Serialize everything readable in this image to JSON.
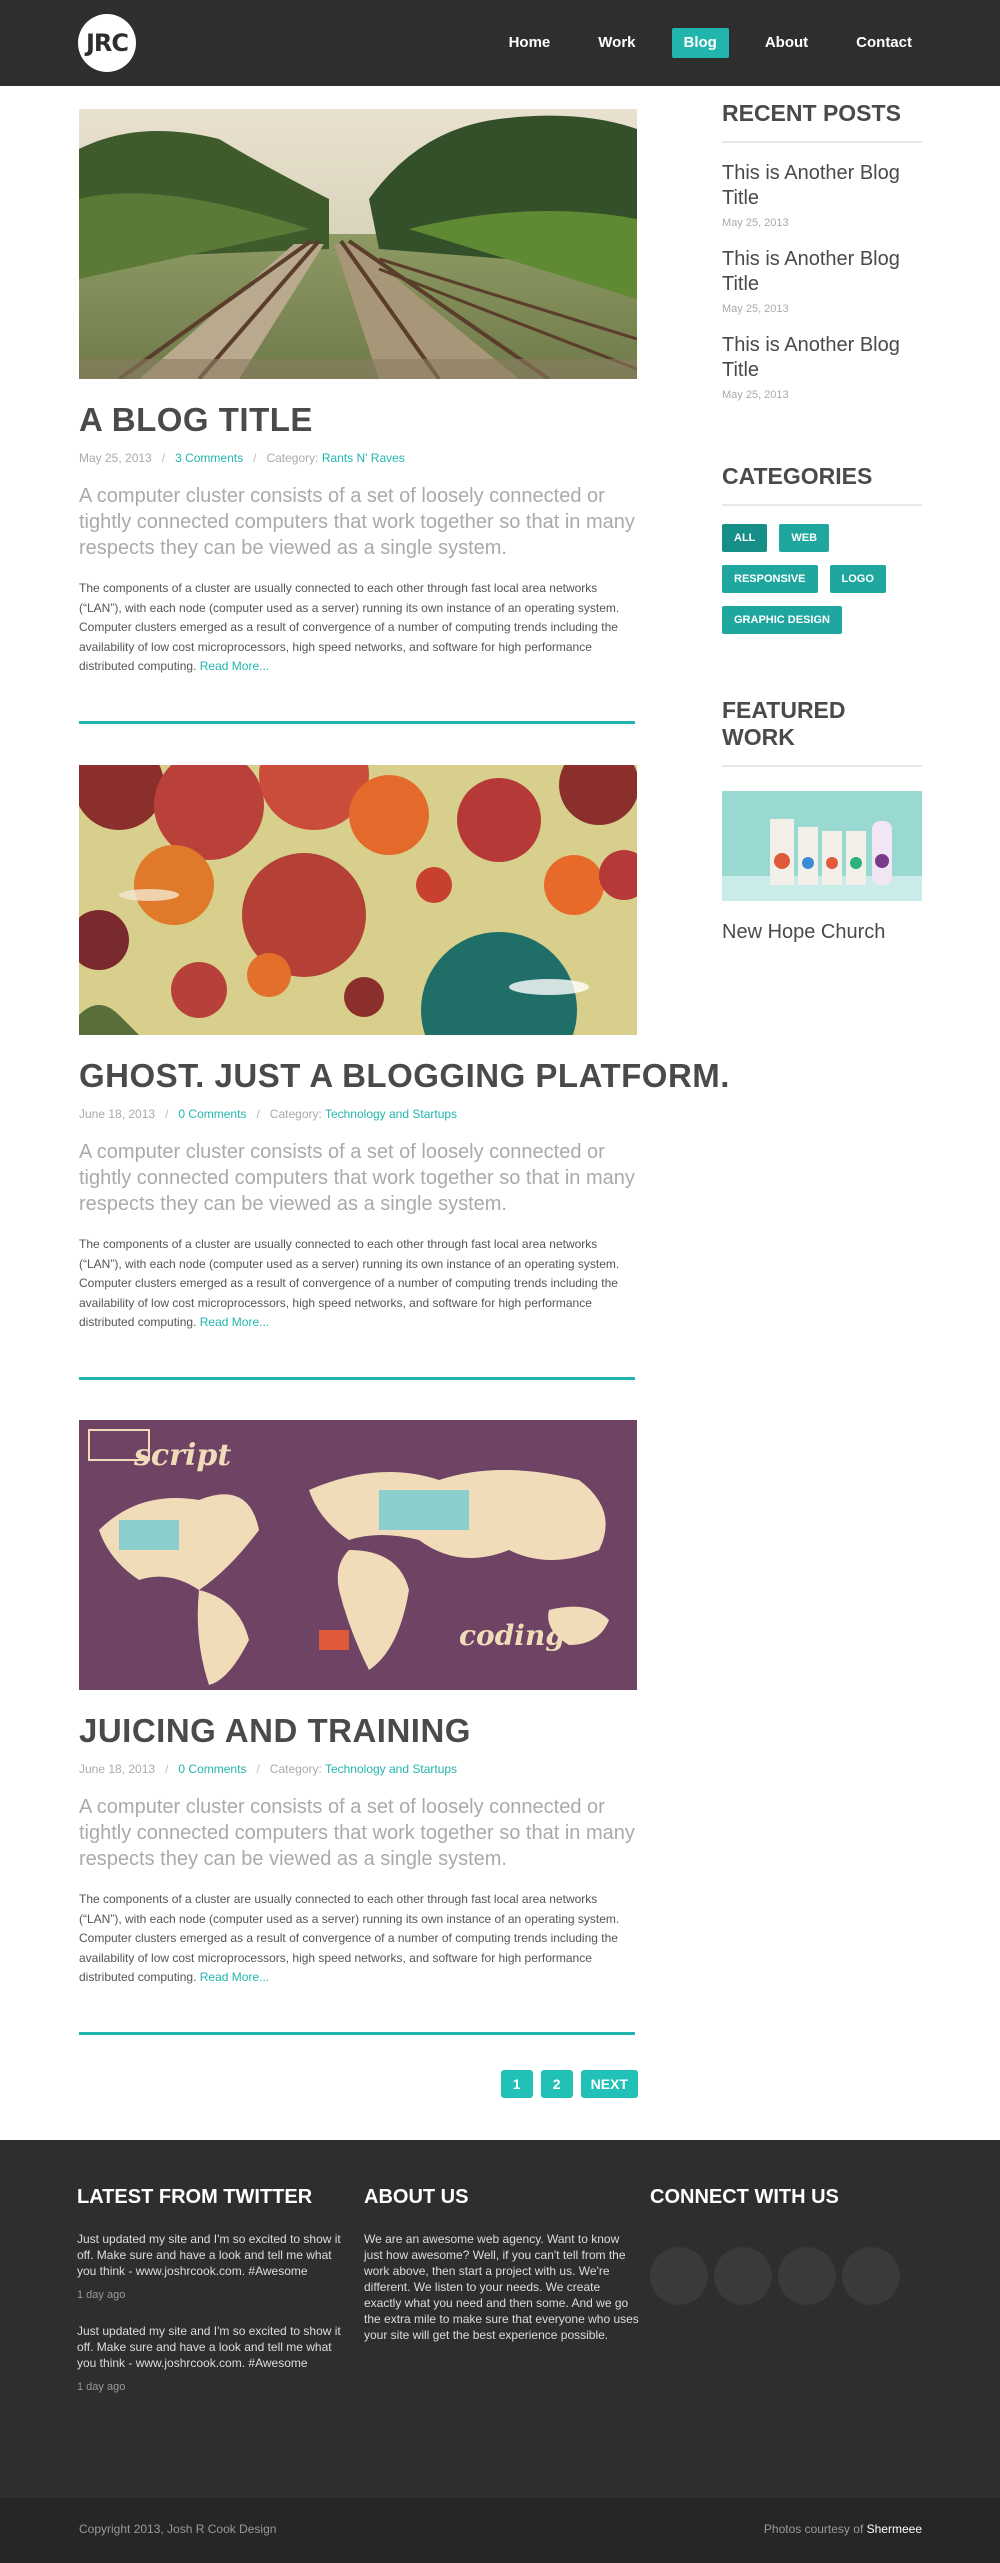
{
  "header": {
    "logo": "JRC",
    "nav": [
      {
        "label": "Home",
        "active": false
      },
      {
        "label": "Work",
        "active": false
      },
      {
        "label": "Blog",
        "active": true
      },
      {
        "label": "About",
        "active": false
      },
      {
        "label": "Contact",
        "active": false
      }
    ]
  },
  "posts": [
    {
      "title": "A BLOG TITLE",
      "date": "May 25, 2013",
      "comments": "3 Comments",
      "category_label": "Category:",
      "category": "Rants N' Raves",
      "lead": "A computer cluster consists of a set of loosely connected or tightly connected computers that work together so that in many respects they can be viewed as a single system.",
      "body": "The components of a cluster are usually connected to each other through fast local area networks (“LAN”), with each node (computer used as a server) running its own instance of an operating system. Computer clusters emerged as a result of convergence of a number of computing trends including the availability of low cost microprocessors, high speed networks, and software for high performance distributed computing.",
      "read_more": "Read More..."
    },
    {
      "title": "GHOST. JUST A BLOGGING PLATFORM.",
      "date": "June 18, 2013",
      "comments": "0 Comments",
      "category_label": "Category:",
      "category": "Technology and Startups",
      "lead": "A computer cluster consists of a set of loosely connected or tightly connected computers that work together so that in many respects they can be viewed as a single system.",
      "body": "The components of a cluster are usually connected to each other through fast local area networks (“LAN”), with each node (computer used as a server) running its own instance of an operating system. Computer clusters emerged as a result of convergence of a number of computing trends including the availability of low cost microprocessors, high speed networks, and software for high performance distributed computing.",
      "read_more": "Read More..."
    },
    {
      "title": "JUICING AND TRAINING",
      "date": "June 18, 2013",
      "comments": "0 Comments",
      "category_label": "Category:",
      "category": "Technology and Startups",
      "lead": "A computer cluster consists of a set of loosely connected or tightly connected computers that work together so that in many respects they can be viewed as a single system.",
      "body": "The components of a cluster are usually connected to each other through fast local area networks (“LAN”), with each node (computer used as a server) running its own instance of an operating system. Computer clusters emerged as a result of convergence of a number of computing trends including the availability of low cost microprocessors, high speed networks, and software for high performance distributed computing.",
      "read_more": "Read More...",
      "image_text": [
        "script",
        "coding"
      ]
    }
  ],
  "sidebar": {
    "recent_heading": "RECENT POSTS",
    "recent": [
      {
        "title": "This is Another Blog Title",
        "date": "May 25, 2013"
      },
      {
        "title": "This is Another Blog Title",
        "date": "May 25, 2013"
      },
      {
        "title": "This is Another Blog Title",
        "date": "May 25, 2013"
      }
    ],
    "categories_heading": "CATEGORIES",
    "categories": [
      "ALL",
      "WEB",
      "RESPONSIVE",
      "LOGO",
      "GRAPHIC DESIGN"
    ],
    "featured_heading": "FEATURED WORK",
    "featured_title": "New Hope Church"
  },
  "pagination": [
    "1",
    "2",
    "NEXT"
  ],
  "footer": {
    "twitter_heading": "LATEST FROM TWITTER",
    "tweets": [
      {
        "text": "Just updated my site and I'm so excited to show it off.  Make sure and have a look and tell me what you think - www.joshrcook.com. #Awesome",
        "time": "1 day ago"
      },
      {
        "text": "Just updated my site and I'm so excited to show it off.  Make sure and have a look and tell me what you think - www.joshrcook.com. #Awesome",
        "time": "1 day ago"
      }
    ],
    "about_heading": "ABOUT US",
    "about_text": "We are an awesome web agency.  Want to know just how awesome?  Well, if you can't tell from the work above, then start a project with us.  We're different.  We listen to your needs.  We create exactly what you need and then some.  And we go the extra mile to make sure that everyone who uses your site will get the best experience possible.",
    "connect_heading": "CONNECT WITH US",
    "copyright": "Copyright 2013, Josh R Cook Design",
    "credit_prefix": "Photos courtesy of",
    "credit_name": "Shermeee"
  },
  "colors": {
    "accent": "#22b5ad",
    "header_bg": "#2e2e2e",
    "footer_bg": "#2e2e2e",
    "bottom_bar_bg": "#262626"
  }
}
